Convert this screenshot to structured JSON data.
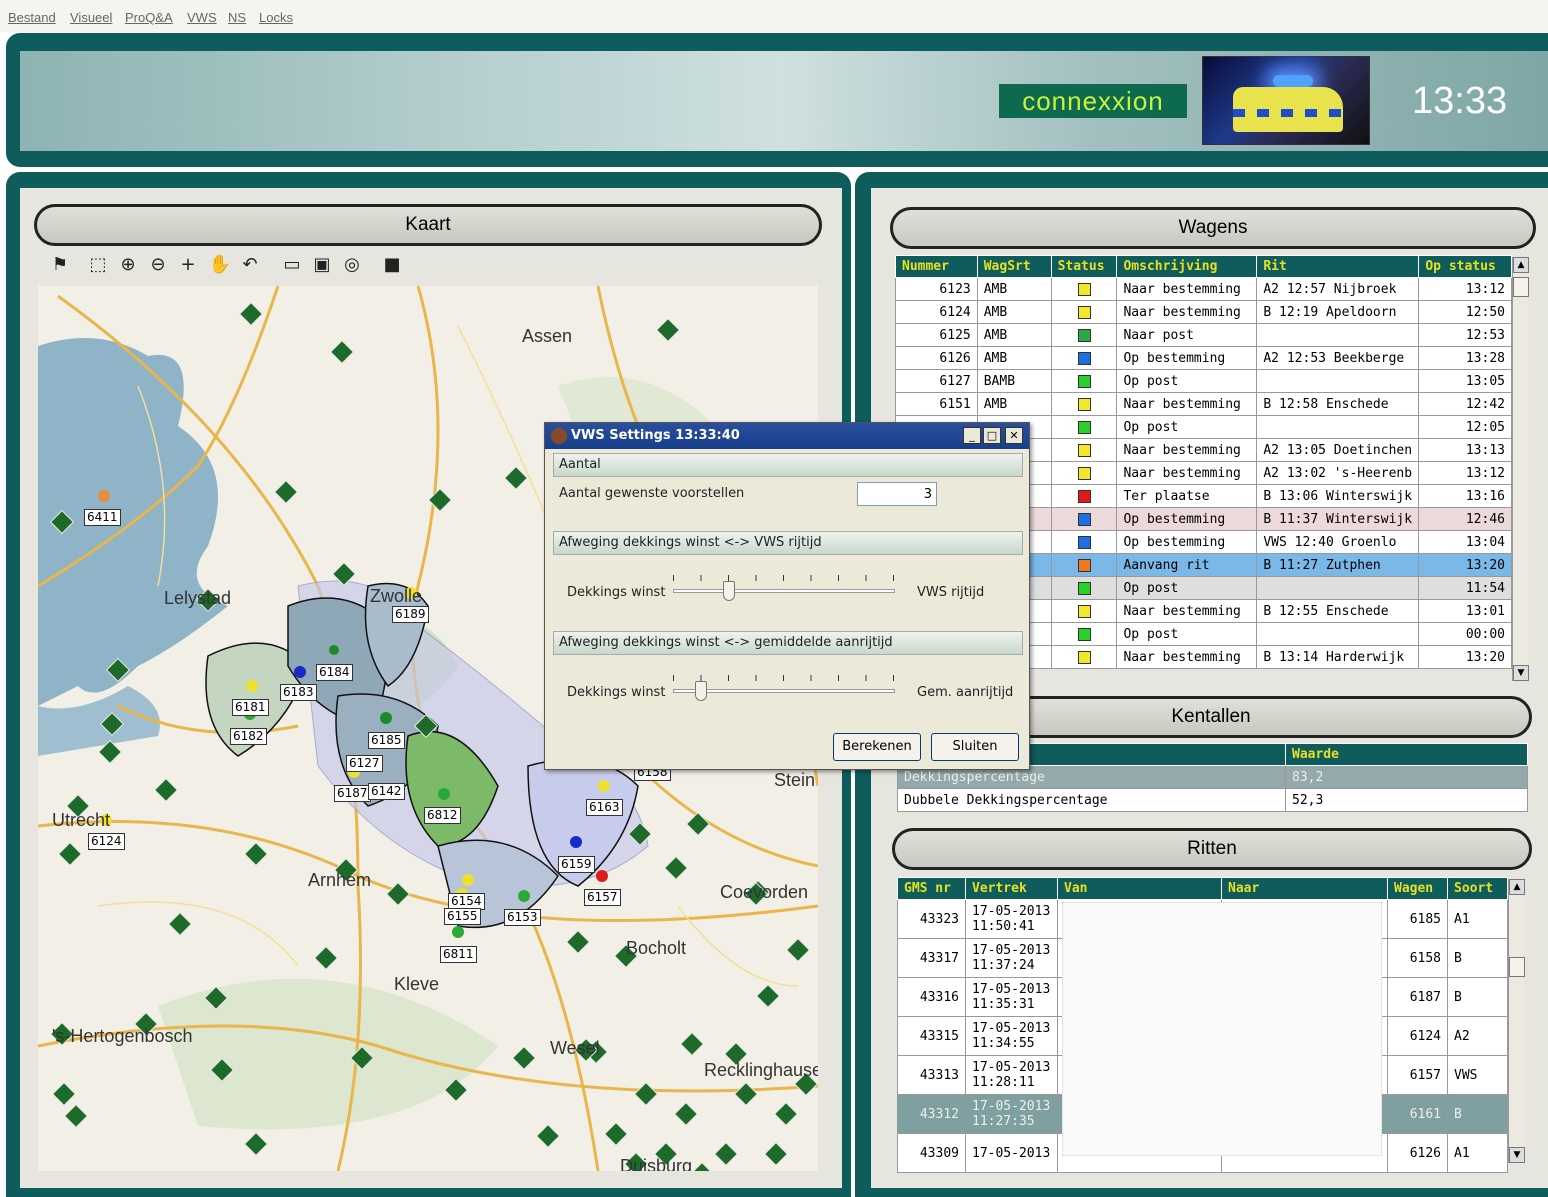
{
  "menu": [
    "Bestand",
    "Visueel",
    "ProQ&A",
    "VWS",
    "NS",
    "Locks"
  ],
  "header": {
    "logo": "connexxion",
    "clock": "13:33"
  },
  "kaart": {
    "title": "Kaart",
    "tools": [
      "pin-icon",
      "select-icon",
      "zoom-in-icon",
      "zoom-out-icon",
      "pan-icon",
      "hand-icon",
      "undo-icon",
      "ruler-icon",
      "grid-icon",
      "globe-icon",
      "save-icon"
    ],
    "cities": [
      "Assen",
      "Lelystad",
      "Zwolle",
      "Utrecht",
      "Arnhem",
      "Stein",
      "Coevorden",
      "Bocholt",
      "Kleve",
      "'s-Hertogenbosch",
      "Wesel",
      "Recklinghausen",
      "Duisburg"
    ],
    "labels": [
      "6411",
      "6189",
      "6184",
      "6183",
      "6181",
      "6182",
      "6185",
      "6127",
      "6187",
      "6812",
      "6124",
      "6163",
      "6159",
      "6157",
      "6154",
      "6155",
      "6153",
      "6811",
      "6158",
      "6142"
    ]
  },
  "wagens": {
    "title": "Wagens",
    "columns": [
      "Nummer",
      "WagSrt",
      "Status",
      "Omschrijving",
      "Rit",
      "Op status"
    ],
    "rows": [
      [
        "6123",
        "AMB",
        "#f2e82a",
        "Naar bestemming",
        "A2 12:57 Nijbroek",
        "13:12",
        ""
      ],
      [
        "6124",
        "AMB",
        "#f2e82a",
        "Naar bestemming",
        "B 12:19 Apeldoorn",
        "12:50",
        ""
      ],
      [
        "6125",
        "AMB",
        "#2aa84a",
        "Naar post",
        "",
        "12:53",
        ""
      ],
      [
        "6126",
        "AMB",
        "#1e6fe0",
        "Op bestemming",
        "A2 12:53 Beekberge",
        "13:28",
        ""
      ],
      [
        "6127",
        "BAMB",
        "#2ad02a",
        "Op post",
        "",
        "13:05",
        ""
      ],
      [
        "6151",
        "AMB",
        "#f2e82a",
        "Naar bestemming",
        "B 12:58 Enschede",
        "12:42",
        ""
      ],
      [
        "",
        "",
        "#2ad02a",
        "Op post",
        "",
        "12:05",
        ""
      ],
      [
        "",
        "",
        "#f2e82a",
        "Naar bestemming",
        "A2 13:05 Doetinchen",
        "13:13",
        ""
      ],
      [
        "",
        "",
        "#f2e82a",
        "Naar bestemming",
        "A2 13:02 's-Heerenb",
        "13:12",
        ""
      ],
      [
        "",
        "",
        "#e01a1a",
        "Ter plaatse",
        "B 13:06 Winterswijk",
        "13:16",
        ""
      ],
      [
        "",
        "",
        "#1e6fe0",
        "Op bestemming",
        "B 11:37 Winterswijk",
        "12:46",
        "pink"
      ],
      [
        "",
        "",
        "#1e6fe0",
        "Op bestemming",
        "VWS 12:40 Groenlo",
        "13:04",
        ""
      ],
      [
        "",
        "",
        "#f07820",
        "Aanvang rit",
        "B 11:27 Zutphen",
        "13:20",
        "sel"
      ],
      [
        "",
        "",
        "#2ad02a",
        "Op post",
        "",
        "11:54",
        "gray"
      ],
      [
        "",
        "",
        "#f2e82a",
        "Naar bestemming",
        "B 12:55 Enschede",
        "13:01",
        ""
      ],
      [
        "",
        "",
        "#2ad02a",
        "Op post",
        "",
        "00:00",
        ""
      ],
      [
        "",
        "",
        "#f2e82a",
        "Naar bestemming",
        "B 13:14 Harderwijk",
        "13:20",
        ""
      ]
    ]
  },
  "kentallen": {
    "title": "Kentallen",
    "col2": "Waarde",
    "rows": [
      [
        "Dekkingspercentage",
        "83,2"
      ],
      [
        "Dubbele Dekkingspercentage",
        "52,3"
      ]
    ]
  },
  "ritten": {
    "title": "Ritten",
    "columns": [
      "GMS nr",
      "Vertrek",
      "Van",
      "Naar",
      "Wagen",
      "Soort"
    ],
    "rows": [
      [
        "43323",
        "17-05-2013",
        "11:50:41",
        "6185",
        "A1",
        ""
      ],
      [
        "43317",
        "17-05-2013",
        "11:37:24",
        "6158",
        "B",
        ""
      ],
      [
        "43316",
        "17-05-2013",
        "11:35:31",
        "6187",
        "B",
        ""
      ],
      [
        "43315",
        "17-05-2013",
        "11:34:55",
        "6124",
        "A2",
        ""
      ],
      [
        "43313",
        "17-05-2013",
        "11:28:11",
        "6157",
        "VWS",
        ""
      ],
      [
        "43312",
        "17-05-2013",
        "11:27:35",
        "6161",
        "B",
        "sel"
      ],
      [
        "43309",
        "17-05-2013",
        "",
        "6126",
        "A1",
        ""
      ]
    ]
  },
  "dialog": {
    "title": "VWS Settings 13:33:40",
    "sect1": "Aantal",
    "aantal_label": "Aantal gewenste voorstellen",
    "aantal_value": "3",
    "sect2": "Afweging dekkings winst <-> VWS rijtijd",
    "s1_left": "Dekkings winst",
    "s1_right": "VWS rijtijd",
    "s1_pos": 0.25,
    "sect3": "Afweging dekkings winst <-> gemiddelde aanrijtijd",
    "s2_left": "Dekkings winst",
    "s2_right": "Gem. aanrijtijd",
    "s2_pos": 0.125,
    "btn_calc": "Berekenen",
    "btn_close": "Sluiten"
  }
}
